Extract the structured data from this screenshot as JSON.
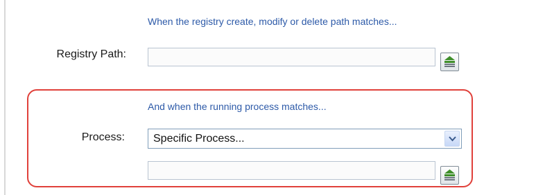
{
  "registry": {
    "hint": "When the registry create, modify or delete path matches...",
    "label": "Registry Path:",
    "path_value": "",
    "browse_icon": "browse-list-icon"
  },
  "process": {
    "hint": "And when the running process matches...",
    "label": "Process:",
    "selected": "Specific Process...",
    "dropdown_icon": "chevron-down-icon",
    "name_value": "",
    "browse_icon": "browse-list-icon"
  },
  "colors": {
    "highlight": "#e0403a",
    "hint_text": "#2d5aa8",
    "browse_green": "#3f8f2a"
  }
}
